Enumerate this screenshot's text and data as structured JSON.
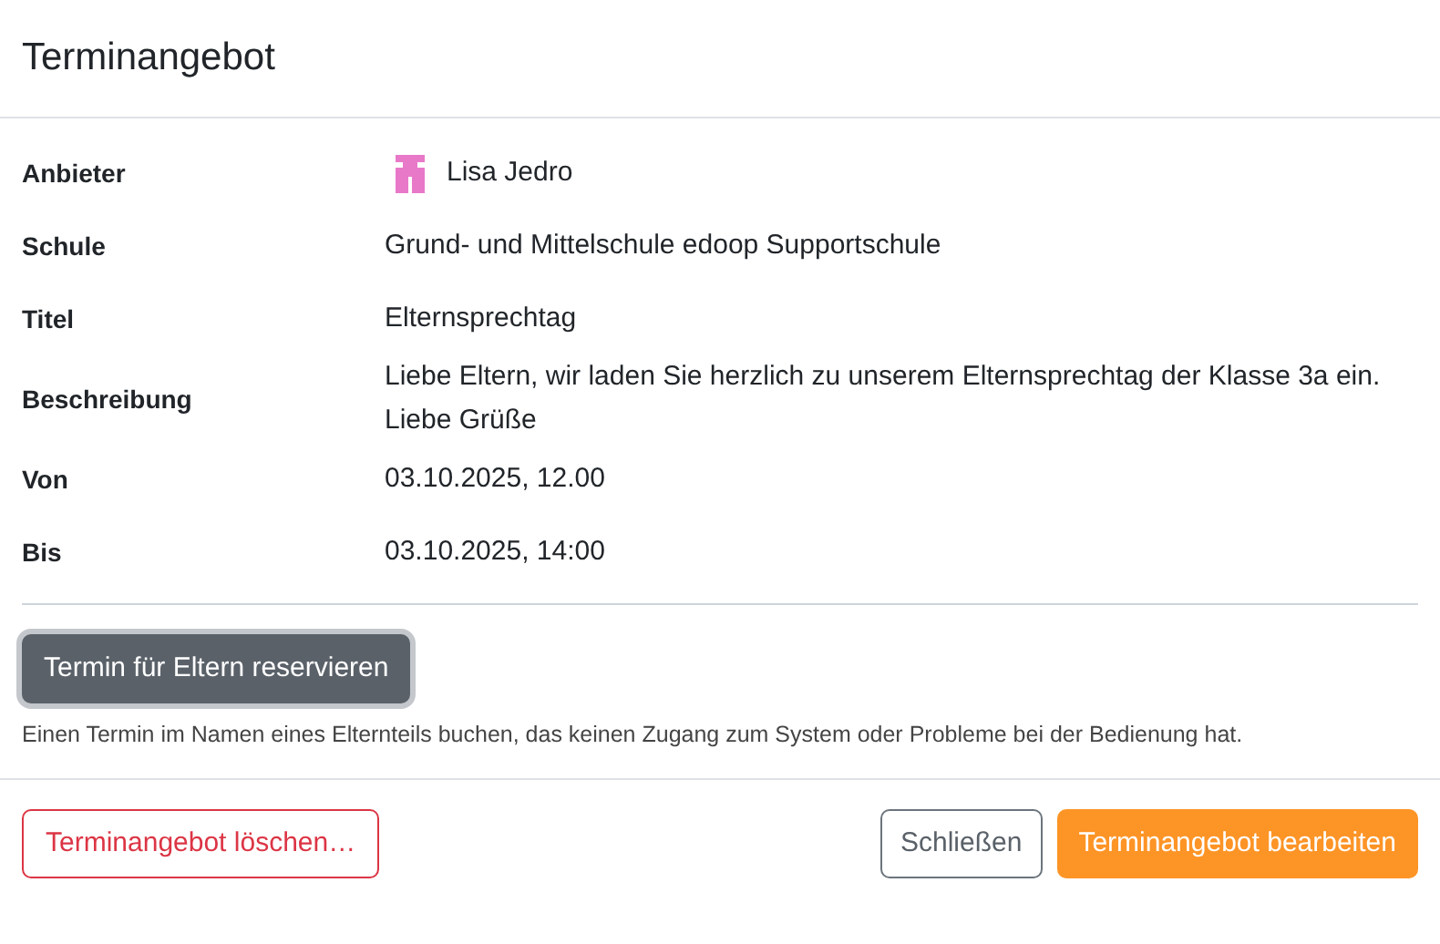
{
  "dialog": {
    "title": "Terminangebot"
  },
  "details": [
    {
      "label": "Anbieter",
      "value": "Lisa Jedro",
      "kind": "person"
    },
    {
      "label": "Schule",
      "value": "Grund- und Mittelschule edoop Supportschule",
      "kind": "text"
    },
    {
      "label": "Titel",
      "value": "Elternsprechtag",
      "kind": "text"
    },
    {
      "label": "Beschreibung",
      "value": "Liebe Eltern, wir laden Sie herzlich zu unserem Elternsprechtag der Klasse 3a ein. Liebe Grüße",
      "kind": "text"
    },
    {
      "label": "Von",
      "value": "03.10.2025, 12.00",
      "kind": "text"
    },
    {
      "label": "Bis",
      "value": "03.10.2025, 14:00",
      "kind": "text"
    }
  ],
  "reserve_button": {
    "label": "Termin für Eltern reservieren"
  },
  "reserve_hint": "Einen Termin im Namen eines Elternteils buchen, das keinen Zugang zum System oder Probleme bei der Bedienung hat.",
  "footer": {
    "delete_button": "Terminangebot löschen…",
    "close_button": "Schließen",
    "edit_button": "Terminangebot bearbeiten"
  }
}
